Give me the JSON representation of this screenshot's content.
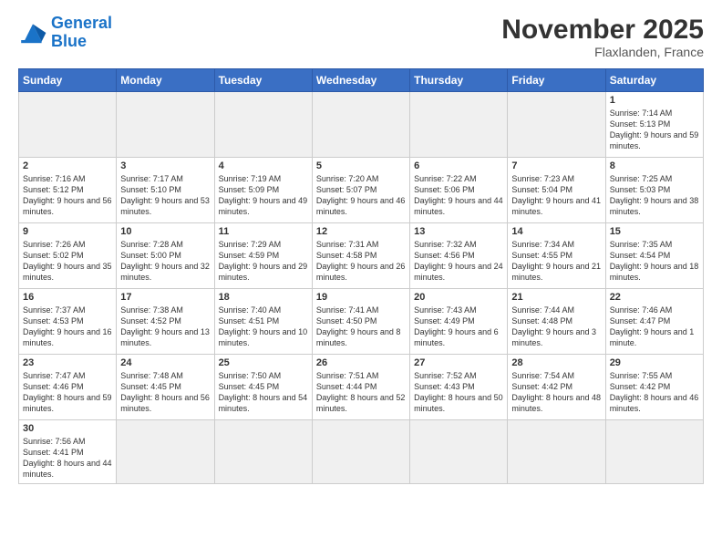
{
  "logo": {
    "general": "General",
    "blue": "Blue"
  },
  "header": {
    "month": "November 2025",
    "location": "Flaxlanden, France"
  },
  "weekdays": [
    "Sunday",
    "Monday",
    "Tuesday",
    "Wednesday",
    "Thursday",
    "Friday",
    "Saturday"
  ],
  "weeks": [
    [
      {
        "day": "",
        "info": "",
        "empty": true
      },
      {
        "day": "",
        "info": "",
        "empty": true
      },
      {
        "day": "",
        "info": "",
        "empty": true
      },
      {
        "day": "",
        "info": "",
        "empty": true
      },
      {
        "day": "",
        "info": "",
        "empty": true
      },
      {
        "day": "",
        "info": "",
        "empty": true
      },
      {
        "day": "1",
        "info": "Sunrise: 7:14 AM\nSunset: 5:13 PM\nDaylight: 9 hours\nand 59 minutes."
      }
    ],
    [
      {
        "day": "2",
        "info": "Sunrise: 7:16 AM\nSunset: 5:12 PM\nDaylight: 9 hours\nand 56 minutes."
      },
      {
        "day": "3",
        "info": "Sunrise: 7:17 AM\nSunset: 5:10 PM\nDaylight: 9 hours\nand 53 minutes."
      },
      {
        "day": "4",
        "info": "Sunrise: 7:19 AM\nSunset: 5:09 PM\nDaylight: 9 hours\nand 49 minutes."
      },
      {
        "day": "5",
        "info": "Sunrise: 7:20 AM\nSunset: 5:07 PM\nDaylight: 9 hours\nand 46 minutes."
      },
      {
        "day": "6",
        "info": "Sunrise: 7:22 AM\nSunset: 5:06 PM\nDaylight: 9 hours\nand 44 minutes."
      },
      {
        "day": "7",
        "info": "Sunrise: 7:23 AM\nSunset: 5:04 PM\nDaylight: 9 hours\nand 41 minutes."
      },
      {
        "day": "8",
        "info": "Sunrise: 7:25 AM\nSunset: 5:03 PM\nDaylight: 9 hours\nand 38 minutes."
      }
    ],
    [
      {
        "day": "9",
        "info": "Sunrise: 7:26 AM\nSunset: 5:02 PM\nDaylight: 9 hours\nand 35 minutes."
      },
      {
        "day": "10",
        "info": "Sunrise: 7:28 AM\nSunset: 5:00 PM\nDaylight: 9 hours\nand 32 minutes."
      },
      {
        "day": "11",
        "info": "Sunrise: 7:29 AM\nSunset: 4:59 PM\nDaylight: 9 hours\nand 29 minutes."
      },
      {
        "day": "12",
        "info": "Sunrise: 7:31 AM\nSunset: 4:58 PM\nDaylight: 9 hours\nand 26 minutes."
      },
      {
        "day": "13",
        "info": "Sunrise: 7:32 AM\nSunset: 4:56 PM\nDaylight: 9 hours\nand 24 minutes."
      },
      {
        "day": "14",
        "info": "Sunrise: 7:34 AM\nSunset: 4:55 PM\nDaylight: 9 hours\nand 21 minutes."
      },
      {
        "day": "15",
        "info": "Sunrise: 7:35 AM\nSunset: 4:54 PM\nDaylight: 9 hours\nand 18 minutes."
      }
    ],
    [
      {
        "day": "16",
        "info": "Sunrise: 7:37 AM\nSunset: 4:53 PM\nDaylight: 9 hours\nand 16 minutes."
      },
      {
        "day": "17",
        "info": "Sunrise: 7:38 AM\nSunset: 4:52 PM\nDaylight: 9 hours\nand 13 minutes."
      },
      {
        "day": "18",
        "info": "Sunrise: 7:40 AM\nSunset: 4:51 PM\nDaylight: 9 hours\nand 10 minutes."
      },
      {
        "day": "19",
        "info": "Sunrise: 7:41 AM\nSunset: 4:50 PM\nDaylight: 9 hours\nand 8 minutes."
      },
      {
        "day": "20",
        "info": "Sunrise: 7:43 AM\nSunset: 4:49 PM\nDaylight: 9 hours\nand 6 minutes."
      },
      {
        "day": "21",
        "info": "Sunrise: 7:44 AM\nSunset: 4:48 PM\nDaylight: 9 hours\nand 3 minutes."
      },
      {
        "day": "22",
        "info": "Sunrise: 7:46 AM\nSunset: 4:47 PM\nDaylight: 9 hours\nand 1 minute."
      }
    ],
    [
      {
        "day": "23",
        "info": "Sunrise: 7:47 AM\nSunset: 4:46 PM\nDaylight: 8 hours\nand 59 minutes."
      },
      {
        "day": "24",
        "info": "Sunrise: 7:48 AM\nSunset: 4:45 PM\nDaylight: 8 hours\nand 56 minutes."
      },
      {
        "day": "25",
        "info": "Sunrise: 7:50 AM\nSunset: 4:45 PM\nDaylight: 8 hours\nand 54 minutes."
      },
      {
        "day": "26",
        "info": "Sunrise: 7:51 AM\nSunset: 4:44 PM\nDaylight: 8 hours\nand 52 minutes."
      },
      {
        "day": "27",
        "info": "Sunrise: 7:52 AM\nSunset: 4:43 PM\nDaylight: 8 hours\nand 50 minutes."
      },
      {
        "day": "28",
        "info": "Sunrise: 7:54 AM\nSunset: 4:42 PM\nDaylight: 8 hours\nand 48 minutes."
      },
      {
        "day": "29",
        "info": "Sunrise: 7:55 AM\nSunset: 4:42 PM\nDaylight: 8 hours\nand 46 minutes."
      }
    ],
    [
      {
        "day": "30",
        "info": "Sunrise: 7:56 AM\nSunset: 4:41 PM\nDaylight: 8 hours\nand 44 minutes.",
        "last": true
      },
      {
        "day": "",
        "info": "",
        "empty": true,
        "last": true
      },
      {
        "day": "",
        "info": "",
        "empty": true,
        "last": true
      },
      {
        "day": "",
        "info": "",
        "empty": true,
        "last": true
      },
      {
        "day": "",
        "info": "",
        "empty": true,
        "last": true
      },
      {
        "day": "",
        "info": "",
        "empty": true,
        "last": true
      },
      {
        "day": "",
        "info": "",
        "empty": true,
        "last": true
      }
    ]
  ]
}
